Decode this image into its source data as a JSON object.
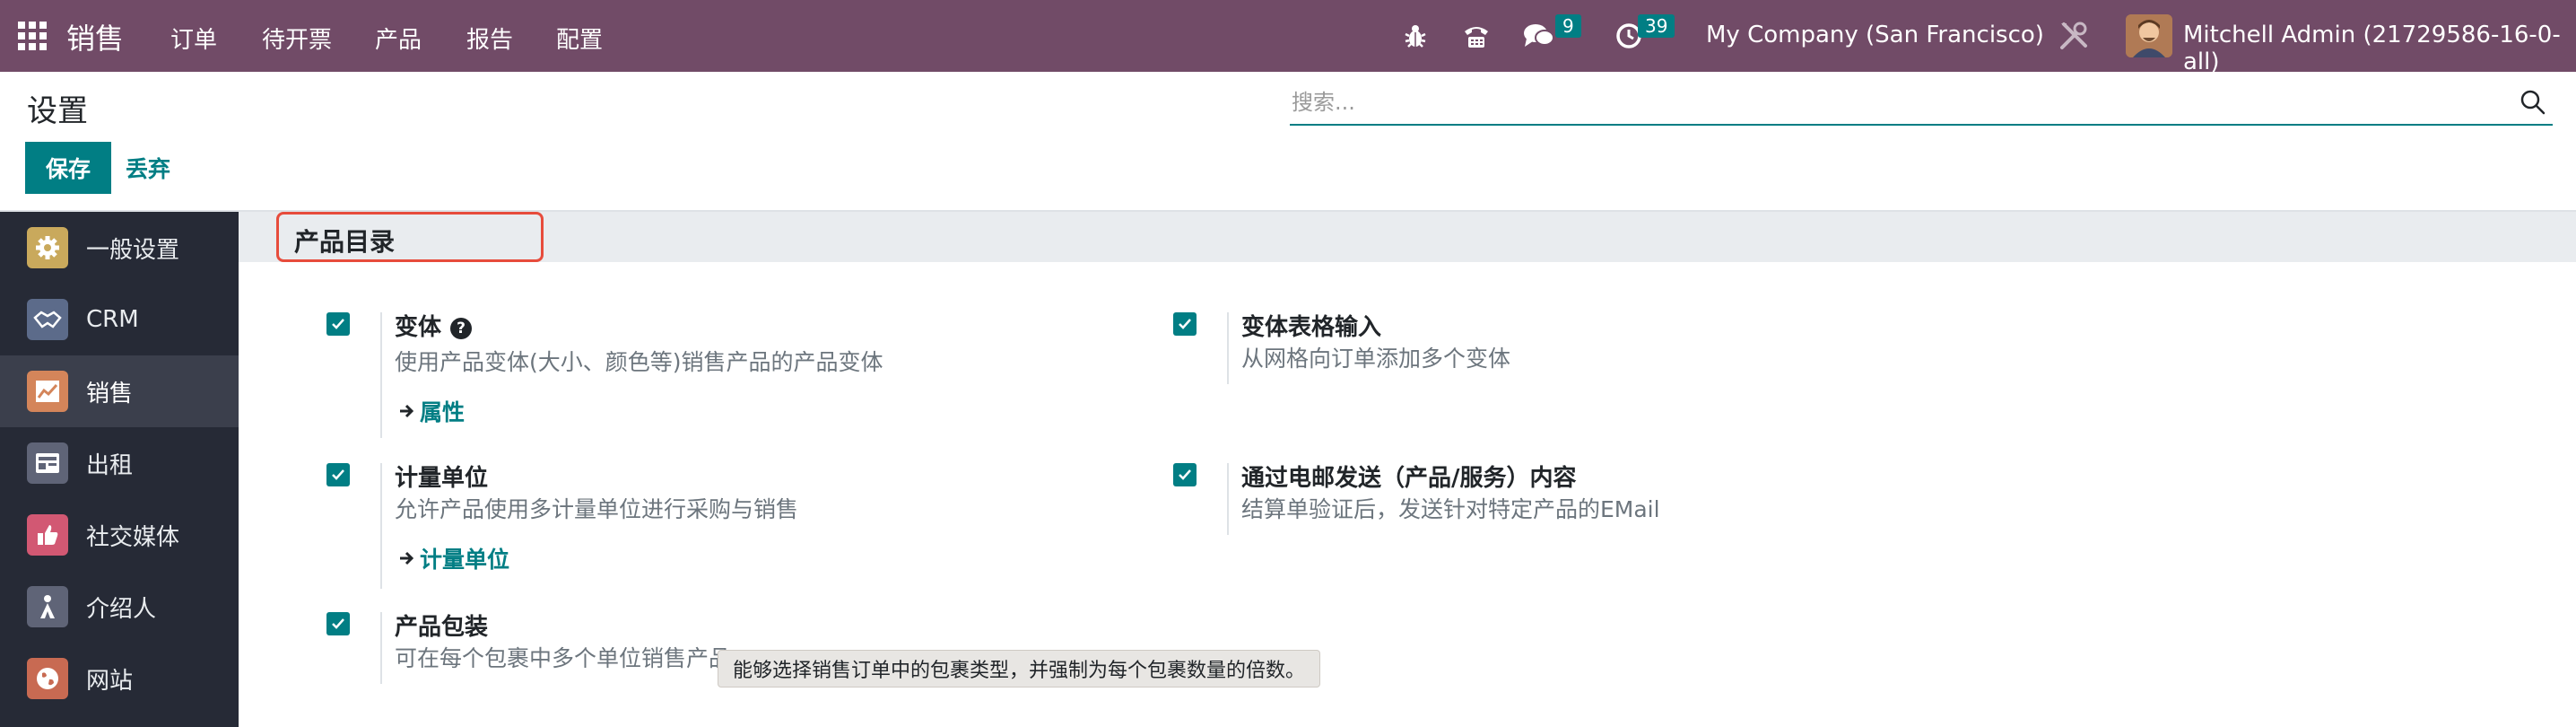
{
  "navbar": {
    "brand": "销售",
    "menu": [
      "订单",
      "待开票",
      "产品",
      "报告",
      "配置"
    ],
    "messages_count": "9",
    "activities_count": "39",
    "company": "My Company (San Francisco)",
    "user": "Mitchell Admin (21729586-16-0-all)"
  },
  "control_panel": {
    "title": "设置",
    "save_label": "保存",
    "discard_label": "丢弃",
    "search_placeholder": "搜索..."
  },
  "sidebar": {
    "items": [
      {
        "label": "一般设置",
        "icon": "gear-icon",
        "color": "#c9a95c"
      },
      {
        "label": "CRM",
        "icon": "handshake-icon",
        "color": "#5c6b8a"
      },
      {
        "label": "销售",
        "icon": "chart-icon",
        "color": "#d4855a",
        "active": true
      },
      {
        "label": "出租",
        "icon": "rental-icon",
        "color": "#5f6477"
      },
      {
        "label": "社交媒体",
        "icon": "thumbs-up-icon",
        "color": "#d25873"
      },
      {
        "label": "介绍人",
        "icon": "referral-icon",
        "color": "#5f6477"
      },
      {
        "label": "网站",
        "icon": "globe-icon",
        "color": "#c86a52"
      }
    ]
  },
  "section": {
    "title": "产品目录"
  },
  "settings": [
    {
      "title": "变体",
      "desc": "使用产品变体(大小、颜色等)销售产品的产品变体",
      "link": "属性",
      "checked": true,
      "help": "?"
    },
    {
      "title": "变体表格输入",
      "desc": "从网格向订单添加多个变体",
      "checked": true
    },
    {
      "title": "计量单位",
      "desc": "允许产品使用多计量单位进行采购与销售",
      "link": "计量单位",
      "checked": true
    },
    {
      "title": "通过电邮发送（产品/服务）内容",
      "desc": "结算单验证后，发送针对特定产品的EMail",
      "checked": true
    },
    {
      "title": "产品包装",
      "desc": "可在每个包裹中多个单位销售产品",
      "checked": true
    }
  ],
  "tooltip": "能够选择销售订单中的包裹类型，并强制为每个包裹数量的倍数。",
  "colors": {
    "navbar": "#714b67",
    "accent": "#017e84",
    "sidebar": "#262a36",
    "highlight": "#e74c3c"
  }
}
